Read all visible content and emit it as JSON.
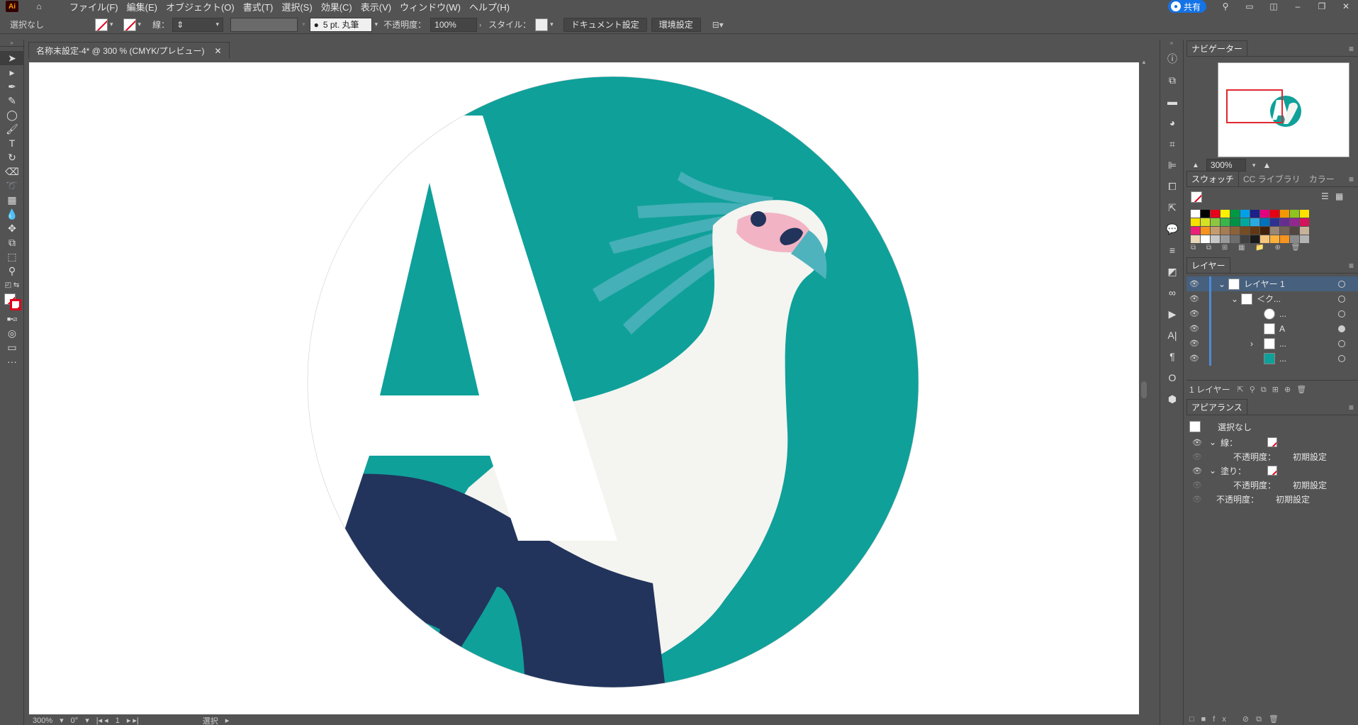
{
  "app": {
    "logo": "Ai",
    "share_label": "共有"
  },
  "menu": [
    "ファイル(F)",
    "編集(E)",
    "オブジェクト(O)",
    "書式(T)",
    "選択(S)",
    "効果(C)",
    "表示(V)",
    "ウィンドウ(W)",
    "ヘルプ(H)"
  ],
  "control": {
    "selection": "選択なし",
    "stroke_label": "線：",
    "brush": "5 pt. 丸筆",
    "opacity_label": "不透明度：",
    "opacity_value": "100%",
    "style_label": "スタイル：",
    "doc_setup": "ドキュメント設定",
    "prefs": "環境設定"
  },
  "document": {
    "tab_title": "名称未設定-4* @ 300 % (CMYK/プレビュー)",
    "zoom": "300%",
    "rotation": "0°",
    "artboard_num": "1",
    "status_tool": "選択"
  },
  "artwork": {
    "letter": "A",
    "colors": {
      "teal": "#0fa09a",
      "navy": "#22345c",
      "white": "#ffffff",
      "offwhite": "#f4f4f0",
      "pink": "#f2b4c4",
      "beak": "#4fb3bd",
      "crest": "#6fc3c8"
    }
  },
  "navigator": {
    "tab": "ナビゲーター",
    "zoom": "300%"
  },
  "swatches": {
    "tabs": [
      "スウォッチ",
      "CC ライブラリ",
      "カラー"
    ],
    "colors": [
      "#ffffff",
      "#000000",
      "#e6001a",
      "#fff100",
      "#009944",
      "#00a0e9",
      "#1d2088",
      "#e4007f",
      "#e60012",
      "#f39800",
      "#8fc31f",
      "#ffe100",
      "#f5e000",
      "#d7df23",
      "#8cc63f",
      "#39b54a",
      "#009245",
      "#00a99d",
      "#29abe2",
      "#0071bc",
      "#2e3192",
      "#662d91",
      "#93278f",
      "#d4145a",
      "#ed1e79",
      "#f7931e",
      "#c69c6d",
      "#a67c52",
      "#8c6239",
      "#754c24",
      "#603813",
      "#42210b",
      "#998675",
      "#736357",
      "#534741",
      "#c7b299",
      "#e8d8b8",
      "#ffffff",
      "#c8c8c8",
      "#9a9a9a",
      "#6d6d6d",
      "#414141",
      "#1a1a1a",
      "#f5c67d",
      "#fbb03b",
      "#f7931e",
      "#8a8a8a",
      "#b3b3b3"
    ]
  },
  "layers": {
    "tab": "レイヤー",
    "rows": [
      {
        "name": "レイヤー 1",
        "indent": 0,
        "expanded": true
      },
      {
        "name": "＜ク...",
        "indent": 1,
        "expanded": true
      },
      {
        "name": "...",
        "indent": 2
      },
      {
        "name": "A",
        "indent": 2
      },
      {
        "name": "...",
        "indent": 2
      },
      {
        "name": "...",
        "indent": 2
      }
    ],
    "footer": "1 レイヤー"
  },
  "appearance": {
    "tab": "アピアランス",
    "title": "選択なし",
    "stroke_label": "線：",
    "stroke_opacity_label": "不透明度：",
    "stroke_opacity_value": "初期設定",
    "fill_label": "塗り：",
    "fill_opacity_label": "不透明度：",
    "fill_opacity_value": "初期設定",
    "opacity_label": "不透明度：",
    "opacity_value": "初期設定"
  }
}
